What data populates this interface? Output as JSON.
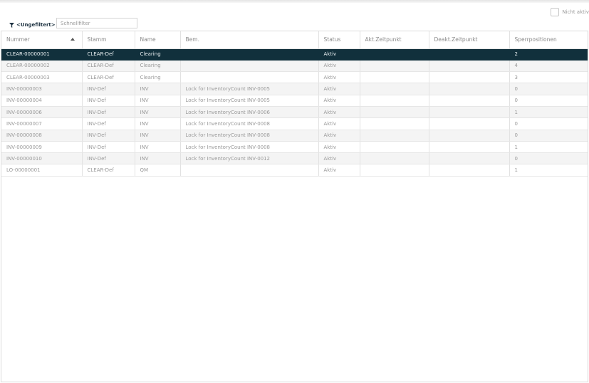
{
  "toolbar": {
    "filter_label": "<Ungefiltert>",
    "quick_filter_placeholder": "Schnellfilter",
    "quick_filter_value": "",
    "inactive_label": "Nicht aktiv"
  },
  "table": {
    "columns": [
      "Nummer",
      "Stamm",
      "Name",
      "Bem.",
      "Status",
      "Akt.Zeitpunkt",
      "Deakt.Zeitpunkt",
      "Sperrpositionen"
    ],
    "sort_column": "Nummer",
    "sort_direction": "asc",
    "selected_row": 0,
    "rows": [
      [
        "CLEAR-00000001",
        "CLEAR-Def",
        "Clearing",
        "",
        "Aktiv",
        "",
        "",
        "2"
      ],
      [
        "CLEAR-00000002",
        "CLEAR-Def",
        "Clearing",
        "",
        "Aktiv",
        "",
        "",
        "4"
      ],
      [
        "CLEAR-00000003",
        "CLEAR-Def",
        "Clearing",
        "",
        "Aktiv",
        "",
        "",
        "3"
      ],
      [
        "INV-00000003",
        "INV-Def",
        "INV",
        "Lock for InventoryCount INV-0005",
        "Aktiv",
        "",
        "",
        "0"
      ],
      [
        "INV-00000004",
        "INV-Def",
        "INV",
        "Lock for InventoryCount INV-0005",
        "Aktiv",
        "",
        "",
        "0"
      ],
      [
        "INV-00000006",
        "INV-Def",
        "INV",
        "Lock for InventoryCount INV-0006",
        "Aktiv",
        "",
        "",
        "1"
      ],
      [
        "INV-00000007",
        "INV-Def",
        "INV",
        "Lock for InventoryCount INV-0008",
        "Aktiv",
        "",
        "",
        "0"
      ],
      [
        "INV-00000008",
        "INV-Def",
        "INV",
        "Lock for InventoryCount INV-0008",
        "Aktiv",
        "",
        "",
        "0"
      ],
      [
        "INV-00000009",
        "INV-Def",
        "INV",
        "Lock for InventoryCount INV-0008",
        "Aktiv",
        "",
        "",
        "1"
      ],
      [
        "INV-00000010",
        "INV-Def",
        "INV",
        "Lock for InventoryCount INV-0012",
        "Aktiv",
        "",
        "",
        "0"
      ],
      [
        "LO-00000001",
        "CLEAR-Def",
        "QM",
        "",
        "Aktiv",
        "",
        "",
        "1"
      ]
    ]
  },
  "colors": {
    "selected_row_bg": "#11303c",
    "filter_accent": "#1c3140"
  },
  "icons": {
    "filter": "funnel-icon",
    "sort": "sort-ascending-icon"
  }
}
